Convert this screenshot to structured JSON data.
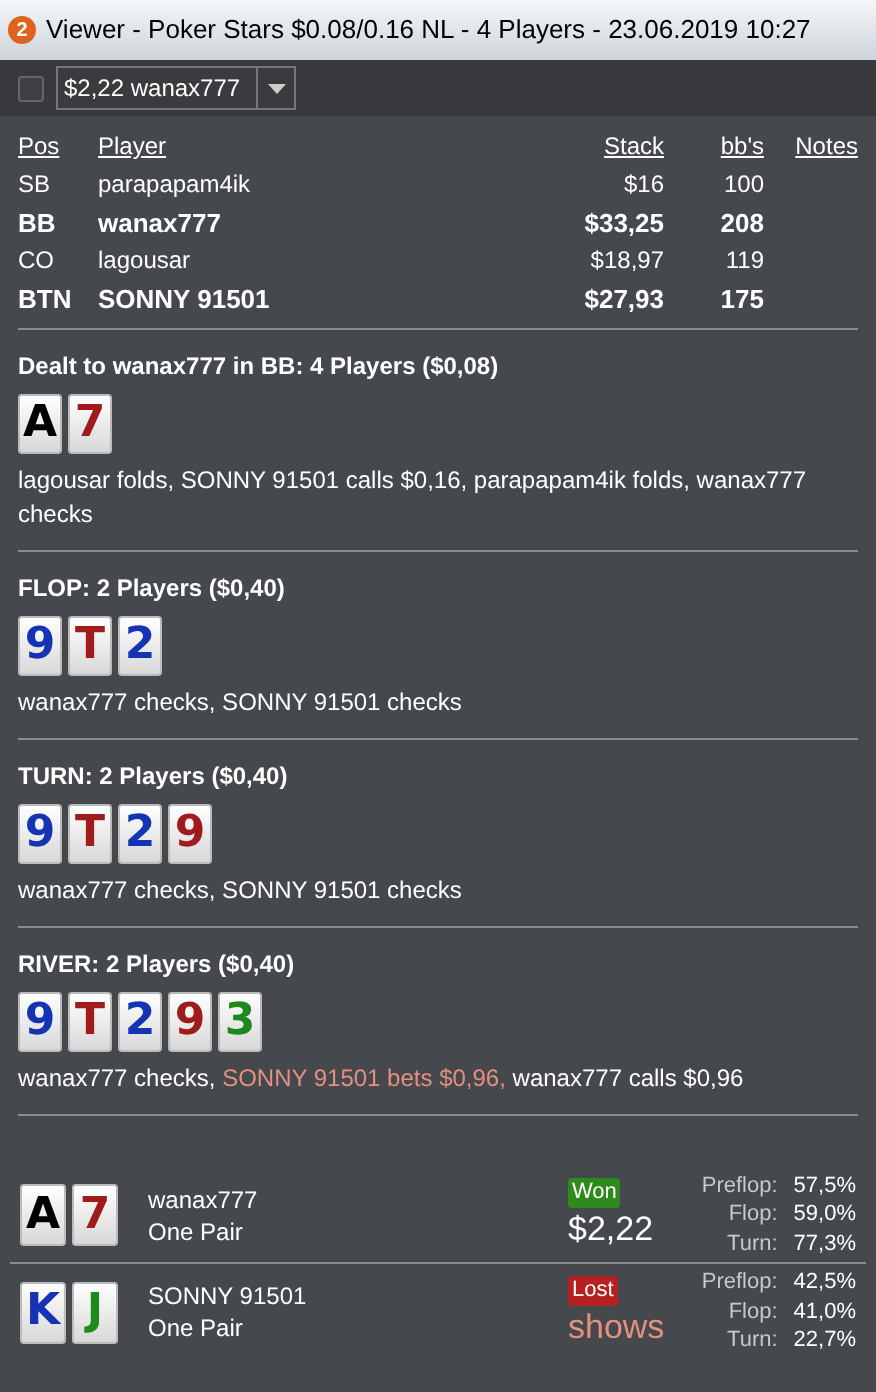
{
  "window": {
    "badge": "2",
    "title": "Viewer - Poker Stars $0.08/0.16 NL - 4 Players - 23.06.2019 10:27"
  },
  "toolbar": {
    "checked": false,
    "selection": "$2,22 wanax777"
  },
  "table": {
    "columns": [
      "Pos",
      "Player",
      "Stack",
      "bb's",
      "Notes"
    ],
    "rows": [
      {
        "pos": "SB",
        "player": "parapapam4ik",
        "stack": "$16",
        "bbs": "100",
        "highlighted": false
      },
      {
        "pos": "BB",
        "player": "wanax777",
        "stack": "$33,25",
        "bbs": "208",
        "highlighted": true
      },
      {
        "pos": "CO",
        "player": "lagousar",
        "stack": "$18,97",
        "bbs": "119",
        "highlighted": false
      },
      {
        "pos": "BTN",
        "player": "SONNY 91501",
        "stack": "$27,93",
        "bbs": "175",
        "highlighted": true
      }
    ]
  },
  "streets": [
    {
      "title": "Dealt to wanax777 in BB: 4 Players ($0,08)",
      "cards": [
        {
          "rank": "A",
          "color": "#000000"
        },
        {
          "rank": "7",
          "color": "#a01c1c"
        }
      ],
      "actions": [
        {
          "text": "lagousar folds, SONNY 91501 calls $0,16, parapapam4ik folds, wanax777 checks",
          "aggressive": false
        }
      ]
    },
    {
      "title": "FLOP: 2 Players ($0,40)",
      "cards": [
        {
          "rank": "9",
          "color": "#1434b4"
        },
        {
          "rank": "T",
          "color": "#a01c1c"
        },
        {
          "rank": "2",
          "color": "#1434b4"
        }
      ],
      "actions": [
        {
          "text": "wanax777 checks, SONNY 91501 checks",
          "aggressive": false
        }
      ]
    },
    {
      "title": "TURN: 2 Players ($0,40)",
      "cards": [
        {
          "rank": "9",
          "color": "#1434b4"
        },
        {
          "rank": "T",
          "color": "#a01c1c"
        },
        {
          "rank": "2",
          "color": "#1434b4"
        },
        {
          "rank": "9",
          "color": "#a01c1c"
        }
      ],
      "actions": [
        {
          "text": "wanax777 checks, SONNY 91501 checks",
          "aggressive": false
        }
      ]
    },
    {
      "title": "RIVER: 2 Players ($0,40)",
      "cards": [
        {
          "rank": "9",
          "color": "#1434b4"
        },
        {
          "rank": "T",
          "color": "#a01c1c"
        },
        {
          "rank": "2",
          "color": "#1434b4"
        },
        {
          "rank": "9",
          "color": "#a01c1c"
        },
        {
          "rank": "3",
          "color": "#1e8a1e"
        }
      ],
      "actions": [
        {
          "text": "wanax777 checks, ",
          "aggressive": false
        },
        {
          "text": "SONNY 91501 bets $0,96, ",
          "aggressive": true
        },
        {
          "text": "wanax777 calls $0,96",
          "aggressive": false
        }
      ]
    }
  ],
  "showdown": [
    {
      "cards": [
        {
          "rank": "A",
          "color": "#000000"
        },
        {
          "rank": "7",
          "color": "#a01c1c"
        }
      ],
      "player": "wanax777",
      "hand": "One Pair",
      "result": {
        "label": "Won",
        "kind": "won"
      },
      "amount": "$2,22",
      "equity": [
        {
          "label": "Preflop:",
          "value": "57,5%"
        },
        {
          "label": "Flop:",
          "value": "59,0%"
        },
        {
          "label": "Turn:",
          "value": "77,3%"
        }
      ]
    },
    {
      "cards": [
        {
          "rank": "K",
          "color": "#1434b4"
        },
        {
          "rank": "J",
          "color": "#1e8a1e"
        }
      ],
      "player": "SONNY 91501",
      "hand": "One Pair",
      "result": {
        "label": "Lost",
        "kind": "lost"
      },
      "amount": "shows",
      "equity": [
        {
          "label": "Preflop:",
          "value": "42,5%"
        },
        {
          "label": "Flop:",
          "value": "41,0%"
        },
        {
          "label": "Turn:",
          "value": "22,7%"
        }
      ]
    }
  ]
}
